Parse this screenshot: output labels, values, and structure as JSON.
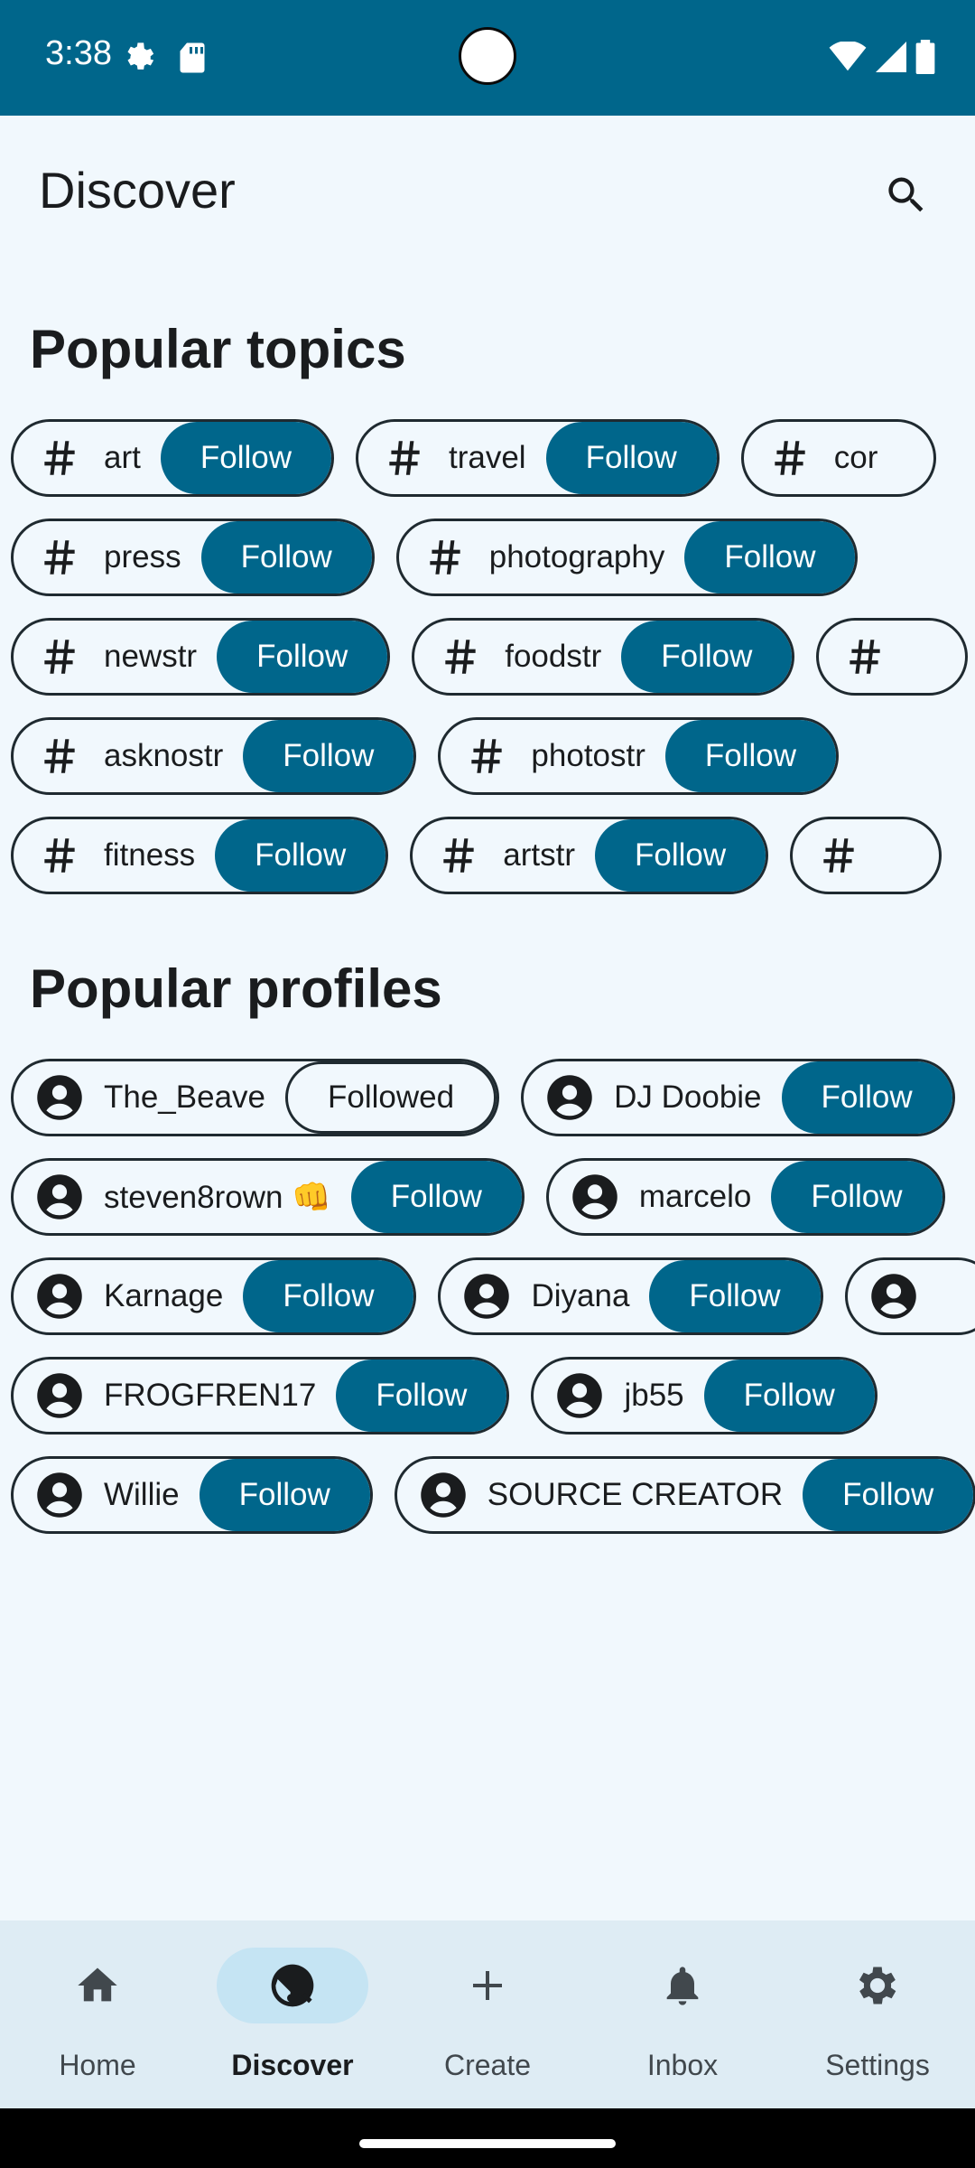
{
  "status_bar": {
    "time": "3:38",
    "icons": [
      "settings-gear-icon",
      "sd-card-icon",
      "wifi-icon",
      "signal-icon",
      "battery-icon"
    ],
    "background": "#00668b"
  },
  "app_bar": {
    "title": "Discover",
    "search_icon": "search-icon"
  },
  "sections": {
    "topics_title": "Popular topics",
    "profiles_title": "Popular profiles"
  },
  "topics": [
    [
      {
        "label": "art",
        "action": "Follow"
      },
      {
        "label": "travel",
        "action": "Follow"
      },
      {
        "label": "cor",
        "action": ""
      }
    ],
    [
      {
        "label": "press",
        "action": "Follow"
      },
      {
        "label": "photography",
        "action": "Follow"
      }
    ],
    [
      {
        "label": "newstr",
        "action": "Follow"
      },
      {
        "label": "foodstr",
        "action": "Follow"
      },
      {
        "label": "",
        "action": ""
      }
    ],
    [
      {
        "label": "asknostr",
        "action": "Follow"
      },
      {
        "label": "photostr",
        "action": "Follow"
      }
    ],
    [
      {
        "label": "fitness",
        "action": "Follow"
      },
      {
        "label": "artstr",
        "action": "Follow"
      },
      {
        "label": "",
        "action": ""
      }
    ]
  ],
  "profiles": [
    [
      {
        "label": "The_Beave",
        "action": "Followed"
      },
      {
        "label": "DJ Doobie",
        "action": "Follow"
      }
    ],
    [
      {
        "label": "steven8rown 👊",
        "action": "Follow"
      },
      {
        "label": "marcelo",
        "action": "Follow"
      }
    ],
    [
      {
        "label": "Karnage",
        "action": "Follow"
      },
      {
        "label": "Diyana",
        "action": "Follow"
      },
      {
        "label": "",
        "action": ""
      }
    ],
    [
      {
        "label": "FROGFREN17",
        "action": "Follow"
      },
      {
        "label": "jb55",
        "action": "Follow"
      }
    ],
    [
      {
        "label": "Willie",
        "action": "Follow"
      },
      {
        "label": "SOURCE CREATOR",
        "action": "Follow"
      }
    ]
  ],
  "nav": {
    "items": [
      {
        "label": "Home",
        "icon": "home-icon",
        "active": false
      },
      {
        "label": "Discover",
        "icon": "discover-icon",
        "active": true
      },
      {
        "label": "Create",
        "icon": "plus-icon",
        "active": false
      },
      {
        "label": "Inbox",
        "icon": "bell-icon",
        "active": false
      },
      {
        "label": "Settings",
        "icon": "gear-icon",
        "active": false
      }
    ]
  },
  "colors": {
    "primary": "#00668b",
    "background": "#f1f8fd",
    "nav_background": "#deecf4",
    "nav_active_pill": "#c5e4f3"
  }
}
